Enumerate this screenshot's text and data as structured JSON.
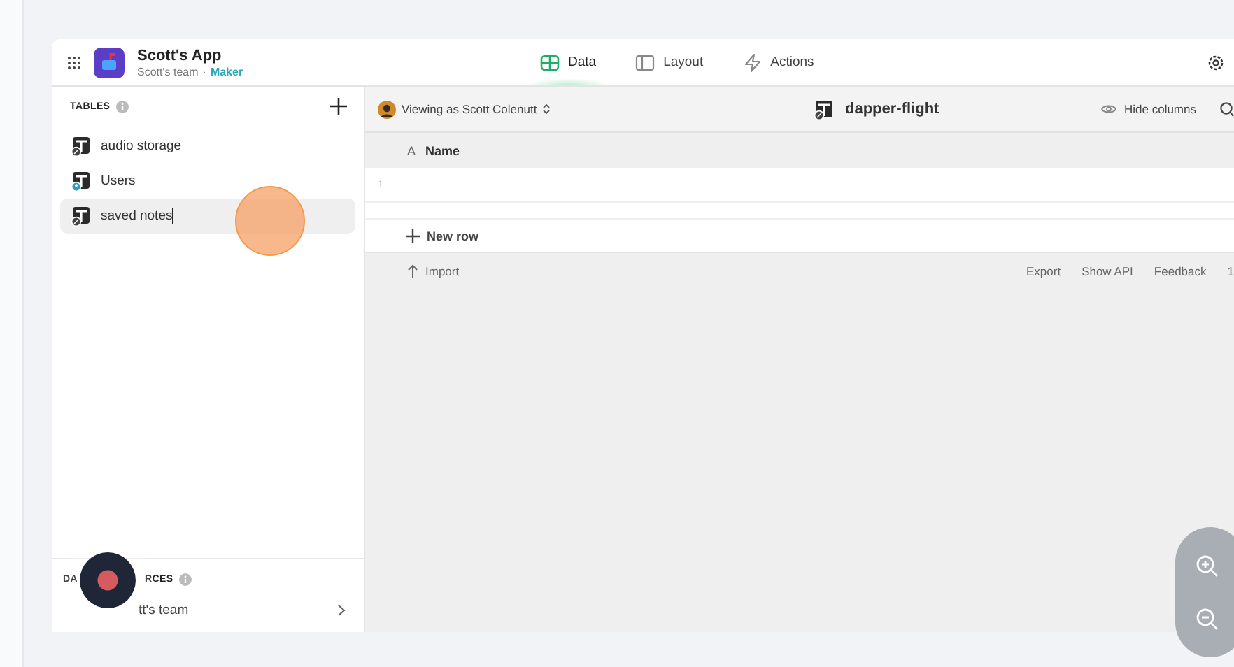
{
  "app": {
    "title": "Scott's App",
    "team": "Scott's team",
    "separator": "·",
    "role": "Maker"
  },
  "tabs": [
    {
      "label": "Data",
      "kind": "grid",
      "selected": true
    },
    {
      "label": "Layout",
      "kind": "layout",
      "selected": false
    },
    {
      "label": "Actions",
      "kind": "bolt",
      "selected": false
    }
  ],
  "sidebar": {
    "tables_heading": "TABLES",
    "tables": [
      {
        "name": "audio storage",
        "kind": "link",
        "selected": false,
        "editing": false
      },
      {
        "name": "Users",
        "kind": "user",
        "selected": false,
        "editing": false
      },
      {
        "name": "saved notes",
        "kind": "link",
        "selected": true,
        "editing": true
      }
    ],
    "sources_heading_parts": [
      "DA",
      "RCES"
    ],
    "source": {
      "label": "tt's team"
    }
  },
  "toolbar": {
    "viewing_as": "Viewing as Scott Colenutt",
    "table_name": "dapper-flight",
    "hide_columns": "Hide columns"
  },
  "grid": {
    "columns": [
      {
        "type_glyph": "A",
        "name": "Name"
      }
    ],
    "rows": [
      {
        "number": "1"
      }
    ],
    "new_row": "New row"
  },
  "footer": {
    "import": "Import",
    "links": [
      "Export",
      "Show API",
      "Feedback",
      "1"
    ]
  }
}
